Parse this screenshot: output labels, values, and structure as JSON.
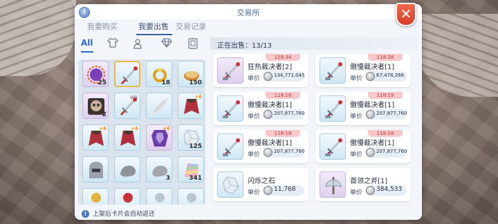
{
  "window": {
    "title": "交易所",
    "close_glyph": "✕",
    "info_glyph": "i"
  },
  "tabs": [
    {
      "label": "我要购买"
    },
    {
      "label": "我要出售"
    },
    {
      "label": "交易记录"
    }
  ],
  "filters": {
    "all_label": "All"
  },
  "inventory": [
    {
      "qty": "25",
      "kind": "orb",
      "color": "#7b3fb8"
    },
    {
      "qty": "",
      "kind": "sword",
      "color": "#c9323c",
      "selected": true
    },
    {
      "qty": "18",
      "kind": "ring",
      "color": "#e2a21b"
    },
    {
      "qty": "150",
      "kind": "bread",
      "color": "#d38d3a"
    },
    {
      "qty": "2",
      "kind": "skull",
      "color": "#5b4a3e"
    },
    {
      "qty": "",
      "kind": "sword",
      "color": "#c9323c",
      "slot": "VIII"
    },
    {
      "qty": "",
      "kind": "bone",
      "color": "#c9c9c9"
    },
    {
      "qty": "",
      "kind": "cape",
      "color": "#b03040",
      "enh": "+6"
    },
    {
      "qty": "",
      "kind": "cape",
      "color": "#b03040",
      "enh": "+6"
    },
    {
      "qty": "",
      "kind": "cape",
      "color": "#b03040",
      "enh": "+6"
    },
    {
      "qty": "",
      "kind": "armor",
      "color": "#6a3fa8",
      "enh": "+6"
    },
    {
      "qty": "125",
      "kind": "gem",
      "color": "#d8e0ea"
    },
    {
      "qty": "",
      "kind": "helm",
      "color": "#9aa3ad"
    },
    {
      "qty": "",
      "kind": "rock",
      "color": "#8e939a"
    },
    {
      "qty": "3",
      "kind": "rock",
      "color": "#a4a8ae"
    },
    {
      "qty": "341",
      "kind": "rainbow",
      "color": "#d98c7a"
    },
    {
      "qty": "",
      "kind": "partial",
      "color": "#e2b33b"
    },
    {
      "qty": "",
      "kind": "partial",
      "color": "#c9323c"
    },
    {
      "qty": "",
      "kind": "partial",
      "color": "#bcc6d1"
    },
    {
      "qty": "",
      "kind": "partial",
      "color": "#bcc6d1"
    }
  ],
  "notice": {
    "text": "上架后卡片会自动返还"
  },
  "sale_header": {
    "text": "正在出售：13/13"
  },
  "listings": [
    {
      "timer": "118:34",
      "name": "狂热裁决者[2]",
      "price_label": "单价",
      "price": "134,771,045",
      "kind": "sword-red"
    },
    {
      "timer": "118:28",
      "name": "傲慢裁决者[1]",
      "price_label": "单价",
      "price": "67,478,266",
      "kind": "sword-blue"
    },
    {
      "timer": "118:18",
      "name": "傲慢裁决者[1]",
      "price_label": "单价",
      "price": "207,877,760",
      "kind": "sword-blue"
    },
    {
      "timer": "118:19",
      "name": "傲慢裁决者[1]",
      "price_label": "单价",
      "price": "207,877,760",
      "kind": "sword-blue"
    },
    {
      "timer": "118:18",
      "name": "傲慢裁决者[1]",
      "price_label": "单价",
      "price": "207,877,760",
      "kind": "sword-blue"
    },
    {
      "timer": "118:18",
      "name": "傲慢裁决者[1]",
      "price_label": "单价",
      "price": "207,877,760",
      "kind": "sword-blue"
    },
    {
      "timer": "",
      "name": "闪烁之石",
      "price_label": "单价",
      "price": "11,768",
      "kind": "crystal"
    },
    {
      "timer": "",
      "name": "首领之斧[1]",
      "price_label": "单价",
      "price": "384,533",
      "kind": "axe"
    }
  ]
}
